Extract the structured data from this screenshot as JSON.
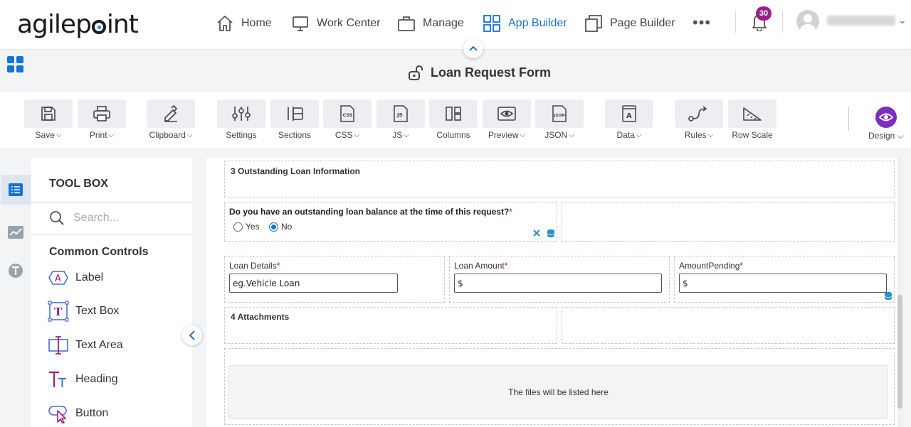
{
  "brand": {
    "logo_text_1": "agilep",
    "logo_text_2": "int"
  },
  "nav": {
    "items": [
      {
        "label": "Home",
        "icon": "home-icon"
      },
      {
        "label": "Work Center",
        "icon": "monitor-icon"
      },
      {
        "label": "Manage",
        "icon": "briefcase-icon"
      },
      {
        "label": "App Builder",
        "icon": "grid-icon",
        "active": true
      },
      {
        "label": "Page Builder",
        "icon": "pages-icon"
      }
    ],
    "more": "•••",
    "notifications_count": "30"
  },
  "form": {
    "title": "Loan Request Form"
  },
  "toolbar": {
    "items": [
      {
        "label": "Save",
        "dropdown": true
      },
      {
        "label": "Print",
        "dropdown": true
      },
      {
        "label": "Clipboard",
        "dropdown": true
      },
      {
        "label": "Settings",
        "dropdown": false
      },
      {
        "label": "Sections",
        "dropdown": false
      },
      {
        "label": "CSS",
        "dropdown": true
      },
      {
        "label": "JS",
        "dropdown": true
      },
      {
        "label": "Columns",
        "dropdown": false
      },
      {
        "label": "Preview",
        "dropdown": true
      },
      {
        "label": "JSON",
        "dropdown": true
      },
      {
        "label": "Data",
        "dropdown": true
      },
      {
        "label": "Rules",
        "dropdown": true
      },
      {
        "label": "Row Scale",
        "dropdown": false
      }
    ],
    "design_label": "Design"
  },
  "toolbox": {
    "title": "TOOL BOX",
    "search_placeholder": "Search...",
    "category": "Common Controls",
    "controls": [
      "Label",
      "Text Box",
      "Text Area",
      "Heading",
      "Button"
    ]
  },
  "canvas": {
    "section3_title": "3 Outstanding Loan Information",
    "question": "Do you have an outstanding loan balance at the time of this request?",
    "radio_yes": "Yes",
    "radio_no": "No",
    "radio_selected": "No",
    "loan_details_label": "Loan Details",
    "loan_details_value": "eg.Vehicle Loan",
    "loan_amount_label": "Loan Amount",
    "loan_amount_value": "$",
    "amount_pending_label": "AmountPending",
    "amount_pending_value": "$",
    "required_mark": "*",
    "section4_title": "4 Attachments",
    "files_placeholder": "The files will be listed here"
  },
  "colors": {
    "accent": "#1672d6",
    "badge": "#9b1f83",
    "design": "#7b2fbf",
    "required": "#d0021b"
  }
}
